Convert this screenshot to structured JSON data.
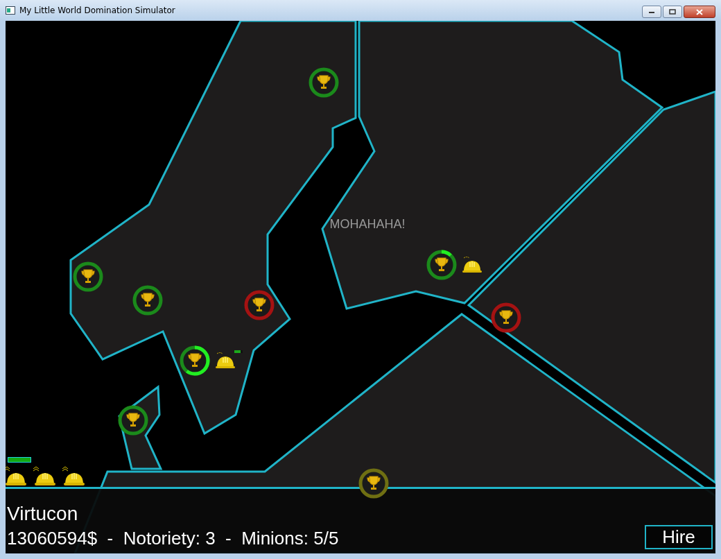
{
  "window": {
    "title": "My Little World Domination Simulator"
  },
  "map": {
    "shout": "MOHAHAHA!",
    "sites": [
      {
        "color": "#1b8a1b"
      },
      {
        "color": "#1b8a1b"
      },
      {
        "color": "#1b8a1b"
      },
      {
        "color": "#a51212"
      },
      {
        "color": "#1b8a1b",
        "level": 0.6,
        "minion": {
          "kind": "worker",
          "level": 0.75
        }
      },
      {
        "color": "#1b8a1b",
        "level": 0.12,
        "minion": {
          "kind": "worker"
        }
      },
      {
        "color": "#a51212"
      },
      {
        "color": "#1b8a1b"
      },
      {
        "color": "#6f6f12"
      }
    ]
  },
  "roster": [
    {
      "kind": "worker",
      "level": 1
    },
    {
      "kind": "worker"
    },
    {
      "kind": "worker"
    }
  ],
  "hud": {
    "organization": "Virtucon",
    "stats": "13060594$  -  Notoriety: 3  -  Minions: 5/5",
    "hire_button": "Hire"
  }
}
